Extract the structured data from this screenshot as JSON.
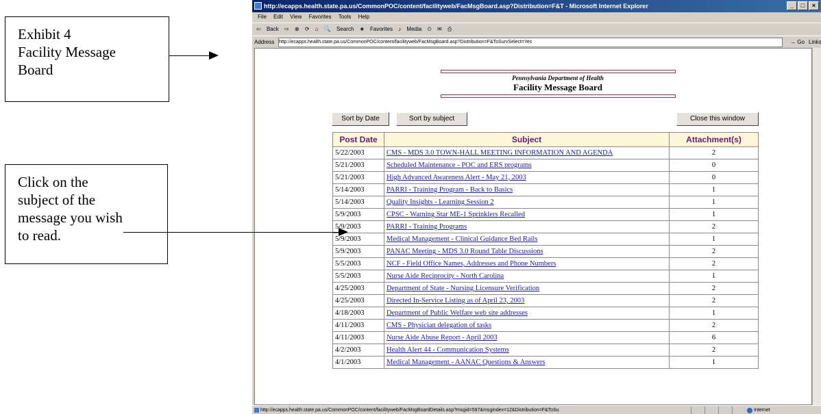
{
  "callouts": {
    "exhibit": [
      "Exhibit 4",
      "Facility Message",
      "Board"
    ],
    "instruction": [
      "Click on the",
      "subject of the",
      "message you wish",
      "to read."
    ]
  },
  "browser": {
    "title": "http://ecapps.health.state.pa.us/CommonPOC/content/facilityweb/FacMsgBoard.asp?Distribution=F&T - Microsoft Internet Explorer",
    "menu": [
      "File",
      "Edit",
      "View",
      "Favorites",
      "Tools",
      "Help"
    ],
    "toolbar": [
      "Back",
      "Search",
      "Favorites",
      "Media"
    ],
    "address_label": "Address",
    "address": "http://ecapps.health.state.pa.us/CommonPOC/content/facilityweb/FacMsgBoard.asp?Distribution=F&ToSurvSelect=Yes",
    "go": "Go",
    "links": "Links",
    "status_url": "http://ecapps.health.state.pa.us/CommonPOC/content/facilityweb/FacMsgBoardDetails.asp?msgid=587&msgindex=12&Distribution=F&ToSu",
    "zone": "Internet"
  },
  "page": {
    "dept": "Pennsylvania Department of Health",
    "title": "Facility Message Board",
    "sort_date": "Sort by Date",
    "sort_subject": "Sort by subject",
    "close": "Close this window"
  },
  "table": {
    "headers": [
      "Post Date",
      "Subject",
      "Attachment(s)"
    ],
    "rows": [
      {
        "date": "5/22/2003",
        "subject": "CMS - MDS 3.0 TOWN-HALL MEETING INFORMATION AND AGENDA",
        "att": "2"
      },
      {
        "date": "5/21/2003",
        "subject": "Scheduled Maintenance - POC and ERS programs",
        "att": "0"
      },
      {
        "date": "5/21/2003",
        "subject": "High Advanced Awareness Alert - May 21, 2003",
        "att": "0"
      },
      {
        "date": "5/14/2003",
        "subject": "PARRI - Training Program - Back to Basics",
        "att": "1"
      },
      {
        "date": "5/14/2003",
        "subject": "Quality Insights - Learning Session 2",
        "att": "1"
      },
      {
        "date": "5/9/2003",
        "subject": "CPSC - Warning Star ME-1 Sprinklers Recalled",
        "att": "1"
      },
      {
        "date": "5/9/2003",
        "subject": "PARRI - Training Programs",
        "att": "2"
      },
      {
        "date": "5/9/2003",
        "subject": "Medical Management - Clinical Guidance Bed Rails",
        "att": "1"
      },
      {
        "date": "5/9/2003",
        "subject": "PANAC Meeting - MDS 3.0 Round Table Discussions",
        "att": "2"
      },
      {
        "date": "5/5/2003",
        "subject": "NCF - Field Office Names, Addresses and Phone Numbers",
        "att": "2"
      },
      {
        "date": "5/5/2003",
        "subject": "Nurse Aide Reciprocity - North Carolina",
        "att": "1"
      },
      {
        "date": "4/25/2003",
        "subject": "Department of State - Nursing Licensure Verification",
        "att": "2"
      },
      {
        "date": "4/25/2003",
        "subject": "Directed In-Service Listing as of April 23, 2003",
        "att": "2"
      },
      {
        "date": "4/18/2003",
        "subject": "Department of Public Welfare web site addresses",
        "att": "1"
      },
      {
        "date": "4/11/2003",
        "subject": "CMS - Physician delegation of tasks",
        "att": "2"
      },
      {
        "date": "4/11/2003",
        "subject": "Nurse Aide Abuse Report - April 2003",
        "att": "6"
      },
      {
        "date": "4/2/2003",
        "subject": "Health Alert 44 - Communication Systems",
        "att": "2"
      },
      {
        "date": "4/1/2003",
        "subject": "Medical Management - AANAC Questions & Answers",
        "att": "1"
      }
    ]
  }
}
